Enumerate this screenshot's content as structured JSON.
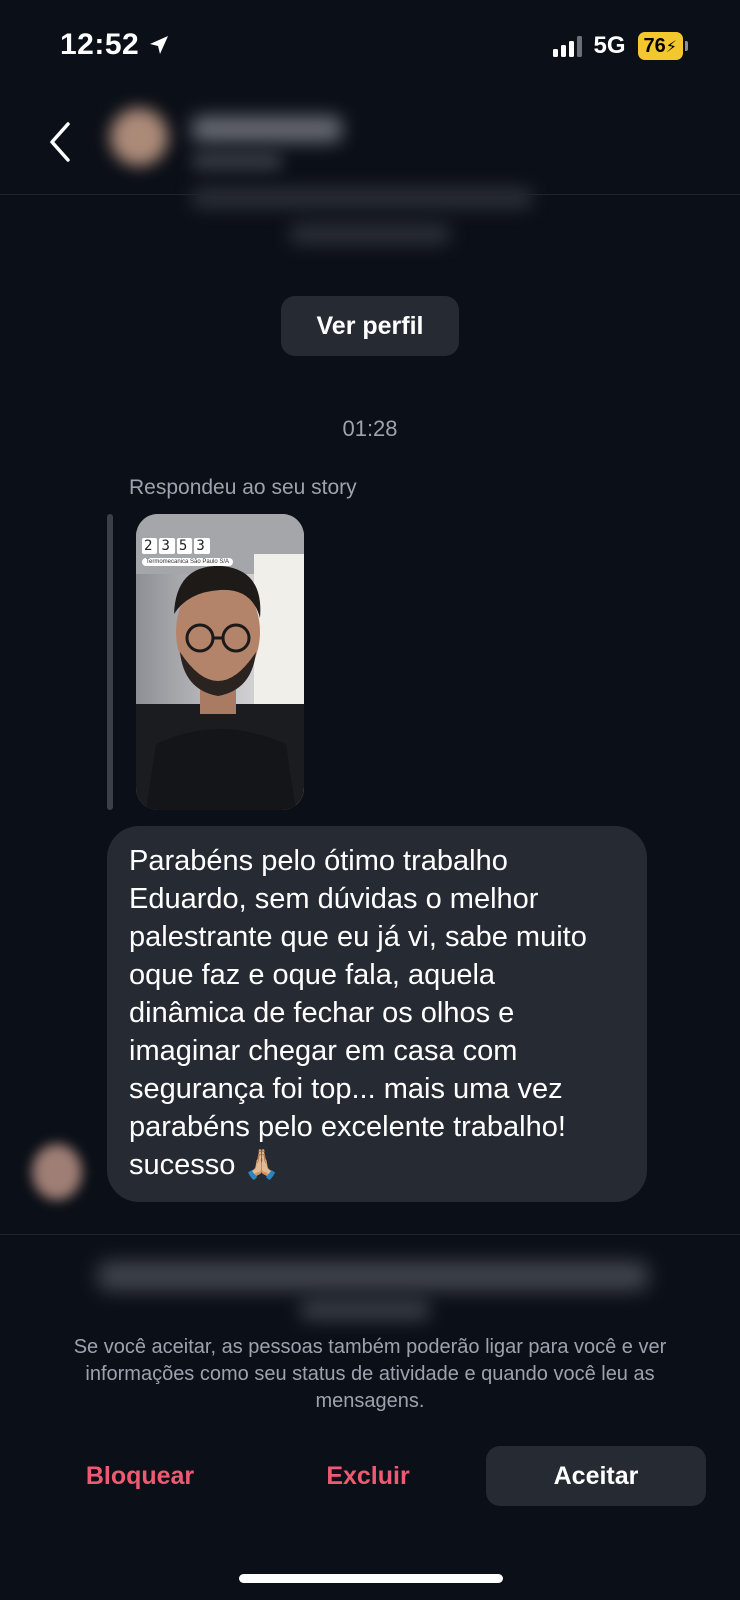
{
  "status_bar": {
    "time": "12:52",
    "network": "5G",
    "battery": "76"
  },
  "header": {
    "view_profile_label": "Ver perfil"
  },
  "thread": {
    "timestamp": "01:28",
    "reply_label": "Respondeu ao seu story",
    "story": {
      "time_digits": [
        "2",
        "3",
        "5",
        "3"
      ],
      "location": "Termomecanica São Paulo S/A"
    },
    "message_lines": [
      "Parabéns pelo ótimo trabalho",
      "Eduardo, sem dúvidas o melhor",
      "palestrante que eu já vi, sabe muito",
      "oque faz e oque fala, aquela",
      "dinâmica de fechar os olhos e",
      "imaginar chegar em casa com",
      "segurança foi top... mais uma vez",
      "parabéns pelo excelente trabalho!",
      "sucesso 🙏🏼"
    ]
  },
  "request": {
    "info_text": "Se você aceitar, as pessoas também poderão ligar para você e ver informações como seu status de atividade e quando você leu as mensagens.",
    "block_label": "Bloquear",
    "delete_label": "Excluir",
    "accept_label": "Aceitar"
  },
  "colors": {
    "background": "#0b0f17",
    "bubble": "#262a33",
    "danger": "#ee5a72",
    "battery": "#f3c82f"
  }
}
